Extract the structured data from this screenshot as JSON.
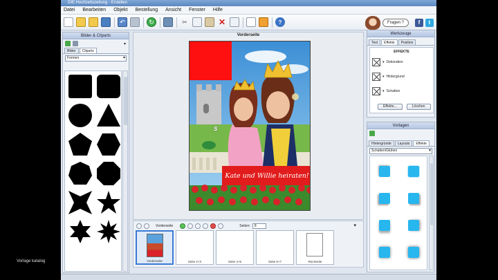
{
  "window": {
    "title": "DIE Hochzeitszeitung - Erstellen"
  },
  "menu": {
    "items": [
      "Datei",
      "Bearbeiten",
      "Objekt",
      "Bestellung",
      "Ansicht",
      "Fenster",
      "Hilfe"
    ]
  },
  "help": {
    "bubble": "Fragen ?"
  },
  "left_panel": {
    "title": "Bilder & Cliparts",
    "tabs": [
      "Bilder",
      "Cliparts"
    ],
    "category": "Formen"
  },
  "canvas": {
    "title": "Vorderseite",
    "banner_text": "Kate und Willie heiraten!"
  },
  "pages_strip": {
    "label": "Vorderseite",
    "seiten_label": "Seiten:",
    "seiten_value": "8",
    "thumbnails": [
      "Vorderseite",
      "Seite 2+3",
      "Seite 4+5",
      "Seite 6+7",
      "Rückseite"
    ]
  },
  "right_panel": {
    "title": "Werkzeuge",
    "tabs": [
      "Text",
      "Effekte",
      "Position"
    ],
    "effects_heading": "EFFEKTE",
    "effects": [
      "Dekoration",
      "Hintergrund",
      "Schatten"
    ],
    "buttons": [
      "Effekte...",
      "Löschen"
    ]
  },
  "vorlagen_panel": {
    "title": "Vorlagen",
    "tabs": [
      "Hintergründe",
      "Layouts",
      "Effekte"
    ],
    "category": "Schatten/Glühen"
  },
  "watermark": "Vorlage katalog",
  "colors": {
    "accent_blue": "#28b6ef",
    "banner_red": "#e21c1c",
    "red_box": "#ff1010"
  }
}
